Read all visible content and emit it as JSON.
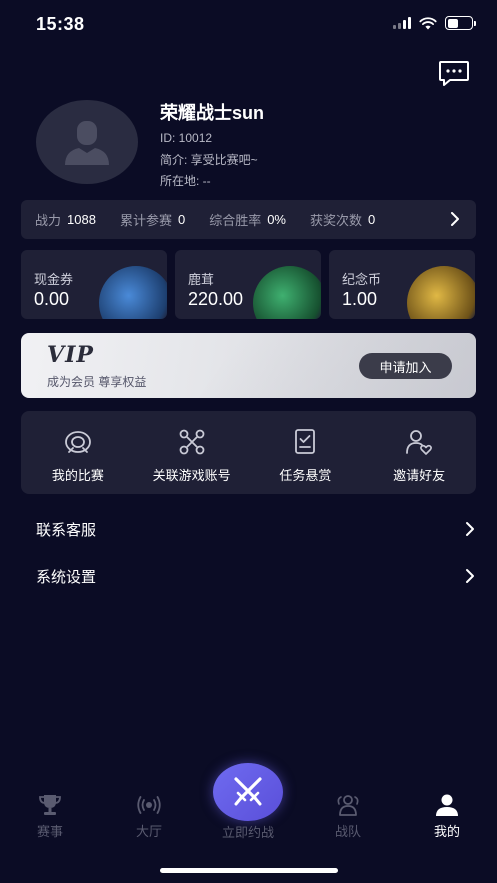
{
  "status_bar": {
    "time": "15:38",
    "battery_level": 0.45
  },
  "header": {
    "message_icon": "chat-bubble-icon"
  },
  "profile": {
    "name": "荣耀战士sun",
    "id_line": "ID: 10012",
    "bio_line": "简介: 享受比赛吧~",
    "location_line": "所在地: --"
  },
  "stats": [
    {
      "label": "战力",
      "value": "1088"
    },
    {
      "label": "累计参赛",
      "value": "0"
    },
    {
      "label": "综合胜率",
      "value": "0%"
    },
    {
      "label": "获奖次数",
      "value": "0"
    }
  ],
  "wallet": [
    {
      "label": "现金券",
      "value": "0.00",
      "color": "#3a78c8"
    },
    {
      "label": "鹿茸",
      "value": "220.00",
      "color": "#2e9a5a"
    },
    {
      "label": "纪念币",
      "value": "1.00",
      "color": "#c8a23a"
    }
  ],
  "vip": {
    "title": "VIP",
    "subtitle": "成为会员 尊享权益",
    "button": "申请加入"
  },
  "features": [
    {
      "label": "我的比赛",
      "icon": "target-icon"
    },
    {
      "label": "关联游戏账号",
      "icon": "link-nodes-icon"
    },
    {
      "label": "任务悬赏",
      "icon": "task-check-icon"
    },
    {
      "label": "邀请好友",
      "icon": "invite-friend-icon"
    }
  ],
  "menu": [
    {
      "label": "联系客服"
    },
    {
      "label": "系统设置"
    }
  ],
  "tabbar": {
    "tabs": [
      {
        "label": "赛事",
        "icon": "trophy-icon"
      },
      {
        "label": "大厅",
        "icon": "broadcast-icon"
      },
      {
        "label": "立即约战",
        "icon": "crossed-swords-icon"
      },
      {
        "label": "战队",
        "icon": "team-icon"
      },
      {
        "label": "我的",
        "icon": "user-icon"
      }
    ],
    "active": "我的"
  },
  "colors": {
    "background": "#0b0c25",
    "card": "#1f2036",
    "accent": "#6f6bf0"
  }
}
